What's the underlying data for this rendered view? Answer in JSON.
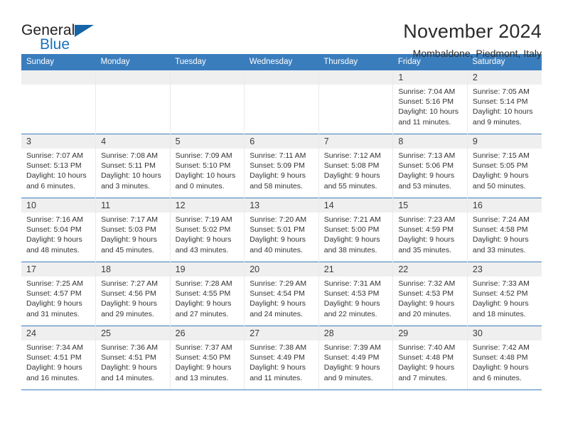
{
  "brand": {
    "name_top": "General",
    "name_bottom": "Blue",
    "triangle_icon": "triangle-icon",
    "color_top": "#231f20",
    "color_bottom": "#1a72ba"
  },
  "header": {
    "title": "November 2024",
    "subtitle": "Mombaldone, Piedmont, Italy"
  },
  "theme": {
    "header_blue": "#3a7dbd",
    "daynum_gray": "#efefef",
    "text": "#333333"
  },
  "weekdays": [
    "Sunday",
    "Monday",
    "Tuesday",
    "Wednesday",
    "Thursday",
    "Friday",
    "Saturday"
  ],
  "labels": {
    "sunrise": "Sunrise:",
    "sunset": "Sunset:",
    "daylight": "Daylight:"
  },
  "weeks": [
    [
      {
        "day": "",
        "lines": []
      },
      {
        "day": "",
        "lines": []
      },
      {
        "day": "",
        "lines": []
      },
      {
        "day": "",
        "lines": []
      },
      {
        "day": "",
        "lines": []
      },
      {
        "day": "1",
        "lines": [
          "Sunrise: 7:04 AM",
          "Sunset: 5:16 PM",
          "Daylight: 10 hours",
          "and 11 minutes."
        ]
      },
      {
        "day": "2",
        "lines": [
          "Sunrise: 7:05 AM",
          "Sunset: 5:14 PM",
          "Daylight: 10 hours",
          "and 9 minutes."
        ]
      }
    ],
    [
      {
        "day": "3",
        "lines": [
          "Sunrise: 7:07 AM",
          "Sunset: 5:13 PM",
          "Daylight: 10 hours",
          "and 6 minutes."
        ]
      },
      {
        "day": "4",
        "lines": [
          "Sunrise: 7:08 AM",
          "Sunset: 5:11 PM",
          "Daylight: 10 hours",
          "and 3 minutes."
        ]
      },
      {
        "day": "5",
        "lines": [
          "Sunrise: 7:09 AM",
          "Sunset: 5:10 PM",
          "Daylight: 10 hours",
          "and 0 minutes."
        ]
      },
      {
        "day": "6",
        "lines": [
          "Sunrise: 7:11 AM",
          "Sunset: 5:09 PM",
          "Daylight: 9 hours",
          "and 58 minutes."
        ]
      },
      {
        "day": "7",
        "lines": [
          "Sunrise: 7:12 AM",
          "Sunset: 5:08 PM",
          "Daylight: 9 hours",
          "and 55 minutes."
        ]
      },
      {
        "day": "8",
        "lines": [
          "Sunrise: 7:13 AM",
          "Sunset: 5:06 PM",
          "Daylight: 9 hours",
          "and 53 minutes."
        ]
      },
      {
        "day": "9",
        "lines": [
          "Sunrise: 7:15 AM",
          "Sunset: 5:05 PM",
          "Daylight: 9 hours",
          "and 50 minutes."
        ]
      }
    ],
    [
      {
        "day": "10",
        "lines": [
          "Sunrise: 7:16 AM",
          "Sunset: 5:04 PM",
          "Daylight: 9 hours",
          "and 48 minutes."
        ]
      },
      {
        "day": "11",
        "lines": [
          "Sunrise: 7:17 AM",
          "Sunset: 5:03 PM",
          "Daylight: 9 hours",
          "and 45 minutes."
        ]
      },
      {
        "day": "12",
        "lines": [
          "Sunrise: 7:19 AM",
          "Sunset: 5:02 PM",
          "Daylight: 9 hours",
          "and 43 minutes."
        ]
      },
      {
        "day": "13",
        "lines": [
          "Sunrise: 7:20 AM",
          "Sunset: 5:01 PM",
          "Daylight: 9 hours",
          "and 40 minutes."
        ]
      },
      {
        "day": "14",
        "lines": [
          "Sunrise: 7:21 AM",
          "Sunset: 5:00 PM",
          "Daylight: 9 hours",
          "and 38 minutes."
        ]
      },
      {
        "day": "15",
        "lines": [
          "Sunrise: 7:23 AM",
          "Sunset: 4:59 PM",
          "Daylight: 9 hours",
          "and 35 minutes."
        ]
      },
      {
        "day": "16",
        "lines": [
          "Sunrise: 7:24 AM",
          "Sunset: 4:58 PM",
          "Daylight: 9 hours",
          "and 33 minutes."
        ]
      }
    ],
    [
      {
        "day": "17",
        "lines": [
          "Sunrise: 7:25 AM",
          "Sunset: 4:57 PM",
          "Daylight: 9 hours",
          "and 31 minutes."
        ]
      },
      {
        "day": "18",
        "lines": [
          "Sunrise: 7:27 AM",
          "Sunset: 4:56 PM",
          "Daylight: 9 hours",
          "and 29 minutes."
        ]
      },
      {
        "day": "19",
        "lines": [
          "Sunrise: 7:28 AM",
          "Sunset: 4:55 PM",
          "Daylight: 9 hours",
          "and 27 minutes."
        ]
      },
      {
        "day": "20",
        "lines": [
          "Sunrise: 7:29 AM",
          "Sunset: 4:54 PM",
          "Daylight: 9 hours",
          "and 24 minutes."
        ]
      },
      {
        "day": "21",
        "lines": [
          "Sunrise: 7:31 AM",
          "Sunset: 4:53 PM",
          "Daylight: 9 hours",
          "and 22 minutes."
        ]
      },
      {
        "day": "22",
        "lines": [
          "Sunrise: 7:32 AM",
          "Sunset: 4:53 PM",
          "Daylight: 9 hours",
          "and 20 minutes."
        ]
      },
      {
        "day": "23",
        "lines": [
          "Sunrise: 7:33 AM",
          "Sunset: 4:52 PM",
          "Daylight: 9 hours",
          "and 18 minutes."
        ]
      }
    ],
    [
      {
        "day": "24",
        "lines": [
          "Sunrise: 7:34 AM",
          "Sunset: 4:51 PM",
          "Daylight: 9 hours",
          "and 16 minutes."
        ]
      },
      {
        "day": "25",
        "lines": [
          "Sunrise: 7:36 AM",
          "Sunset: 4:51 PM",
          "Daylight: 9 hours",
          "and 14 minutes."
        ]
      },
      {
        "day": "26",
        "lines": [
          "Sunrise: 7:37 AM",
          "Sunset: 4:50 PM",
          "Daylight: 9 hours",
          "and 13 minutes."
        ]
      },
      {
        "day": "27",
        "lines": [
          "Sunrise: 7:38 AM",
          "Sunset: 4:49 PM",
          "Daylight: 9 hours",
          "and 11 minutes."
        ]
      },
      {
        "day": "28",
        "lines": [
          "Sunrise: 7:39 AM",
          "Sunset: 4:49 PM",
          "Daylight: 9 hours",
          "and 9 minutes."
        ]
      },
      {
        "day": "29",
        "lines": [
          "Sunrise: 7:40 AM",
          "Sunset: 4:48 PM",
          "Daylight: 9 hours",
          "and 7 minutes."
        ]
      },
      {
        "day": "30",
        "lines": [
          "Sunrise: 7:42 AM",
          "Sunset: 4:48 PM",
          "Daylight: 9 hours",
          "and 6 minutes."
        ]
      }
    ]
  ]
}
